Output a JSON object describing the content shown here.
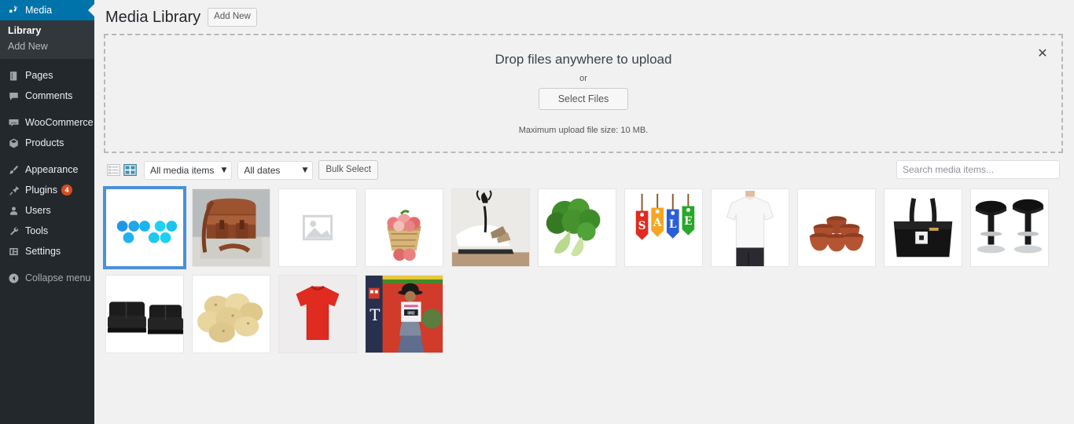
{
  "sidebar": {
    "active_item": "Media",
    "active_icon": "media-icon",
    "submenu": [
      {
        "label": "Library",
        "current": true
      },
      {
        "label": "Add New",
        "current": false
      }
    ],
    "items": [
      {
        "label": "Pages",
        "icon": "pages-icon",
        "badge": null
      },
      {
        "label": "Comments",
        "icon": "comments-icon",
        "badge": null
      },
      {
        "label": "WooCommerce",
        "icon": "woocommerce-icon",
        "badge": null
      },
      {
        "label": "Products",
        "icon": "products-box-icon",
        "badge": null
      },
      {
        "label": "Appearance",
        "icon": "appearance-brush-icon",
        "badge": null
      },
      {
        "label": "Plugins",
        "icon": "plugins-plug-icon",
        "badge": "4"
      },
      {
        "label": "Users",
        "icon": "users-icon",
        "badge": null
      },
      {
        "label": "Tools",
        "icon": "tools-wrench-icon",
        "badge": null
      },
      {
        "label": "Settings",
        "icon": "settings-icon",
        "badge": null
      }
    ],
    "collapse": {
      "label": "Collapse menu",
      "icon": "collapse-arrow-icon"
    },
    "colors": {
      "background": "#23282d",
      "submenu_background": "#32373c",
      "active": "#0073aa",
      "badge": "#d54e21"
    }
  },
  "header": {
    "title": "Media Library",
    "add_new_label": "Add New"
  },
  "uploader": {
    "drop_title": "Drop files anywhere to upload",
    "or_label": "or",
    "select_files_label": "Select Files",
    "max_size_note": "Maximum upload file size: 10 MB.",
    "close_label": "✕"
  },
  "toolbar": {
    "list_view_label": "List view",
    "grid_view_label": "Grid view",
    "active_view": "grid",
    "media_filter": {
      "value": "All media items",
      "caret": "▼"
    },
    "date_filter": {
      "value": "All dates",
      "caret": "▼"
    },
    "bulk_select_label": "Bulk Select",
    "search_placeholder": "Search media items...",
    "search_value": ""
  },
  "media_grid": {
    "items": [
      {
        "name": "blue-dots-logo-image",
        "type": "dots",
        "selected": true
      },
      {
        "name": "leather-messenger-bag-image",
        "type": "bag",
        "selected": false
      },
      {
        "name": "missing-image-placeholder",
        "type": "placeholder",
        "selected": false
      },
      {
        "name": "apples-basket-image",
        "type": "apples",
        "selected": false
      },
      {
        "name": "white-chaise-interior-image",
        "type": "interior",
        "selected": false
      },
      {
        "name": "broccoli-image",
        "type": "broccoli",
        "selected": false
      },
      {
        "name": "sale-tags-image",
        "type": "sale",
        "selected": false
      },
      {
        "name": "white-tshirt-model-image",
        "type": "whiteshirt",
        "selected": false
      },
      {
        "name": "terracotta-cups-image",
        "type": "cups",
        "selected": false
      },
      {
        "name": "black-handbag-image",
        "type": "handbag",
        "selected": false
      },
      {
        "name": "black-bar-stools-image",
        "type": "stools",
        "selected": false
      },
      {
        "name": "black-leather-sofa-image",
        "type": "sofa",
        "selected": false
      },
      {
        "name": "potatoes-image",
        "type": "potatoes",
        "selected": false
      },
      {
        "name": "red-tshirt-image",
        "type": "redshirt",
        "selected": false
      },
      {
        "name": "person-with-sign-image",
        "type": "person",
        "selected": false
      }
    ],
    "sale_tag_letters": [
      "S",
      "A",
      "L",
      "E"
    ],
    "sale_tag_colors": [
      "#e02b20",
      "#f5a623",
      "#2b5fd9",
      "#28a828"
    ]
  }
}
